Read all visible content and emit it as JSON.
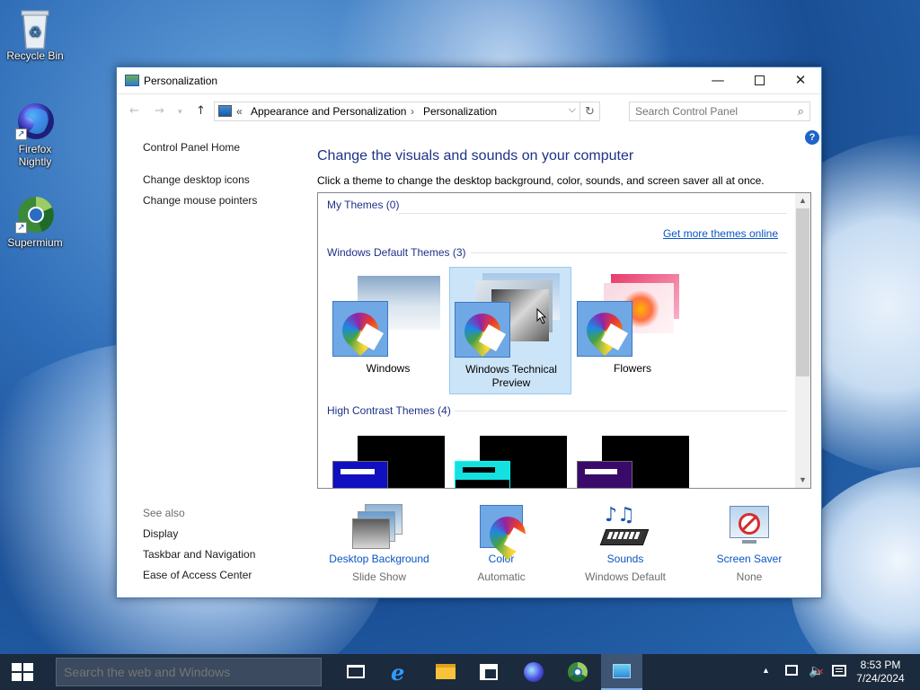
{
  "desktop": {
    "icons": [
      {
        "label": "Recycle Bin"
      },
      {
        "label": "Firefox Nightly"
      },
      {
        "label": "Supermium"
      }
    ]
  },
  "window": {
    "title": "Personalization",
    "address": {
      "prefix": "«",
      "segments": [
        "Appearance and Personalization",
        "Personalization"
      ],
      "separator": "›"
    },
    "search_placeholder": "Search Control Panel",
    "left_nav": {
      "home": "Control Panel Home",
      "links": [
        "Change desktop icons",
        "Change mouse pointers"
      ]
    },
    "see_also": {
      "header": "See also",
      "links": [
        "Display",
        "Taskbar and Navigation",
        "Ease of Access Center"
      ]
    },
    "heading": "Change the visuals and sounds on your computer",
    "subheading": "Click a theme to change the desktop background, color, sounds, and screen saver all at once.",
    "themes": {
      "my_themes": "My Themes (0)",
      "get_more": "Get more themes online",
      "default_header": "Windows Default Themes (3)",
      "default_items": [
        {
          "label": "Windows",
          "selected": false
        },
        {
          "label": "Windows Technical Preview",
          "selected": true
        },
        {
          "label": "Flowers",
          "selected": false
        }
      ],
      "high_contrast_header": "High Contrast Themes (4)"
    },
    "bottom": [
      {
        "name": "Desktop Background",
        "value": "Slide Show"
      },
      {
        "name": "Color",
        "value": "Automatic"
      },
      {
        "name": "Sounds",
        "value": "Windows Default"
      },
      {
        "name": "Screen Saver",
        "value": "None"
      }
    ]
  },
  "taskbar": {
    "search_placeholder": "Search the web and Windows",
    "time": "8:53 PM",
    "date": "7/24/2024"
  },
  "colors": {
    "accent_link": "#0a55c4",
    "heading": "#1e3287",
    "selection": "#cce4f7"
  }
}
